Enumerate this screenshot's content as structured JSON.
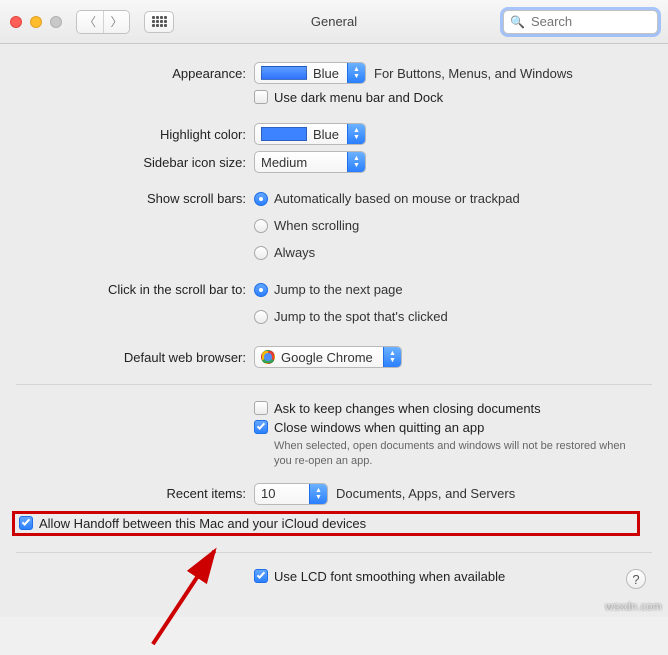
{
  "window": {
    "title": "General"
  },
  "search": {
    "placeholder": "Search"
  },
  "appearance": {
    "label": "Appearance:",
    "value": "Blue",
    "hint": "For Buttons, Menus, and Windows",
    "dark_menu_checked": false,
    "dark_menu_label": "Use dark menu bar and Dock"
  },
  "highlight": {
    "label": "Highlight color:",
    "value": "Blue"
  },
  "sidebar": {
    "label": "Sidebar icon size:",
    "value": "Medium"
  },
  "scroll_show": {
    "label": "Show scroll bars:",
    "options": {
      "auto": {
        "label": "Automatically based on mouse or trackpad",
        "checked": true
      },
      "when": {
        "label": "When scrolling",
        "checked": false
      },
      "always": {
        "label": "Always",
        "checked": false
      }
    }
  },
  "scroll_click": {
    "label": "Click in the scroll bar to:",
    "options": {
      "next": {
        "label": "Jump to the next page",
        "checked": true
      },
      "spot": {
        "label": "Jump to the spot that's clicked",
        "checked": false
      }
    }
  },
  "browser": {
    "label": "Default web browser:",
    "value": "Google Chrome"
  },
  "documents": {
    "ask_label": "Ask to keep changes when closing documents",
    "ask_checked": false,
    "close_label": "Close windows when quitting an app",
    "close_checked": true,
    "close_hint": "When selected, open documents and windows will not be restored when you re-open an app."
  },
  "recent": {
    "label": "Recent items:",
    "value": "10",
    "suffix": "Documents, Apps, and Servers"
  },
  "handoff": {
    "label": "Allow Handoff between this Mac and your iCloud devices",
    "checked": true
  },
  "lcd": {
    "label": "Use LCD font smoothing when available",
    "checked": true
  },
  "watermark": "wsxdn.com"
}
